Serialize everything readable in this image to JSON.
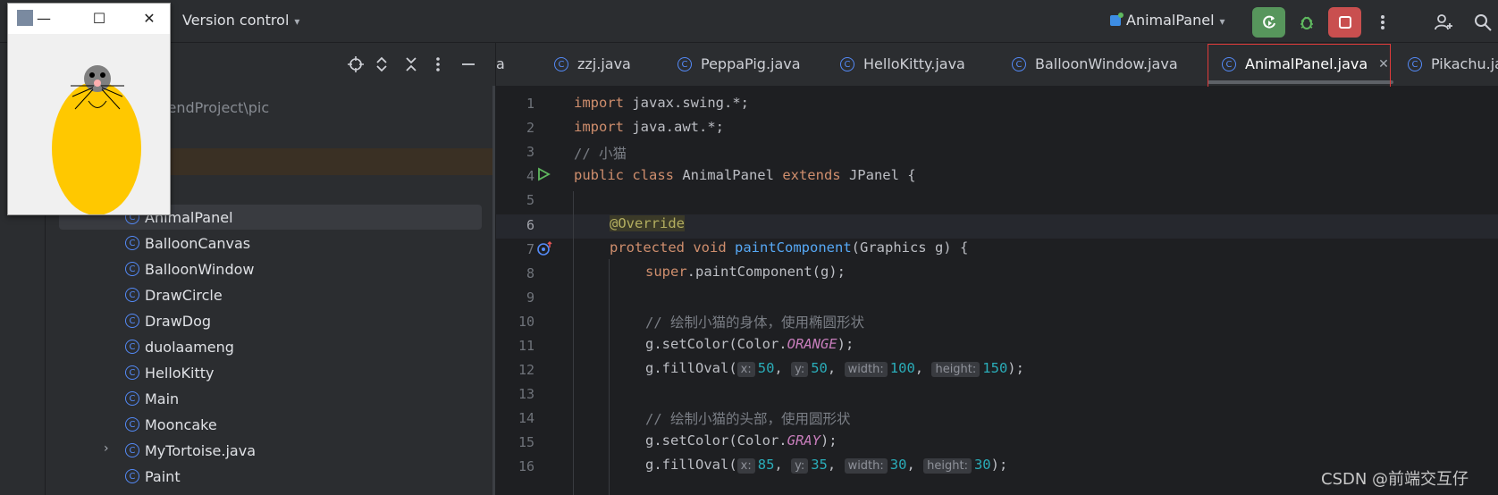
{
  "topbar": {
    "vcs_label": "Version control",
    "run_config": "AnimalPanel",
    "colors": {
      "run": "#57965c",
      "stop": "#c94f4f"
    }
  },
  "project": {
    "path_fragment": "ckendProject\\pic",
    "items": [
      {
        "label": "AnimalPanel",
        "selected": true
      },
      {
        "label": "BalloonCanvas"
      },
      {
        "label": "BalloonWindow"
      },
      {
        "label": "DrawCircle"
      },
      {
        "label": "DrawDog"
      },
      {
        "label": "duolaameng"
      },
      {
        "label": "HelloKitty"
      },
      {
        "label": "Main"
      },
      {
        "label": "Mooncake"
      },
      {
        "label": "MyTortoise.java",
        "expandable": true
      },
      {
        "label": "Paint"
      }
    ]
  },
  "tabs": [
    {
      "label": "a"
    },
    {
      "label": "zzj.java"
    },
    {
      "label": "PeppaPig.java"
    },
    {
      "label": "HelloKitty.java"
    },
    {
      "label": "BalloonWindow.java"
    },
    {
      "label": "AnimalPanel.java",
      "active": true
    },
    {
      "label": "Pikachu.ja"
    }
  ],
  "editor": {
    "current_line": 6,
    "line_numbers": [
      "1",
      "2",
      "3",
      "4",
      "5",
      "6",
      "7",
      "8",
      "9",
      "10",
      "11",
      "12",
      "13",
      "14",
      "15",
      "16"
    ],
    "lines": {
      "l1_kw": "import",
      "l1_rest": " javax.swing.*;",
      "l2_kw": "import",
      "l2_rest": " java.awt.*;",
      "l3": "// 小猫",
      "l4_kw1": "public class",
      "l4_name": " AnimalPanel ",
      "l4_kw2": "extends",
      "l4_rest": " JPanel {",
      "l6": "@Override",
      "l7_kw": "protected void",
      "l7_fn": "paintComponent",
      "l7_rest": "(Graphics g) {",
      "l8_kw": "super",
      "l8_rest": ".paintComponent(g);",
      "l10": "// 绘制小猫的身体，使用椭圆形状",
      "l11_a": "g.setColor(Color.",
      "l11_c": "ORANGE",
      "l11_b": ");",
      "l12_a": "g.fillOval(",
      "l12_h1": "x:",
      "l12_v1": "50",
      "l12_h2": "y:",
      "l12_v2": "50",
      "l12_h3": "width:",
      "l12_v3": "100",
      "l12_h4": "height:",
      "l12_v4": "150",
      "l12_b": ");",
      "l14": "// 绘制小猫的头部，使用圆形状",
      "l15_a": "g.setColor(Color.",
      "l15_c": "GRAY",
      "l15_b": ");",
      "l16_a": "g.fillOval(",
      "l16_h1": "x:",
      "l16_v1": "85",
      "l16_h2": "y:",
      "l16_v2": "35",
      "l16_h3": "width:",
      "l16_v3": "30",
      "l16_h4": "height:",
      "l16_v4": "30",
      "l16_b": ");"
    }
  },
  "swing_window": {
    "colors": {
      "body": "#ffc800",
      "head": "#808080",
      "nose": "#ffafaf"
    }
  },
  "watermark": "CSDN @前端交互仔"
}
